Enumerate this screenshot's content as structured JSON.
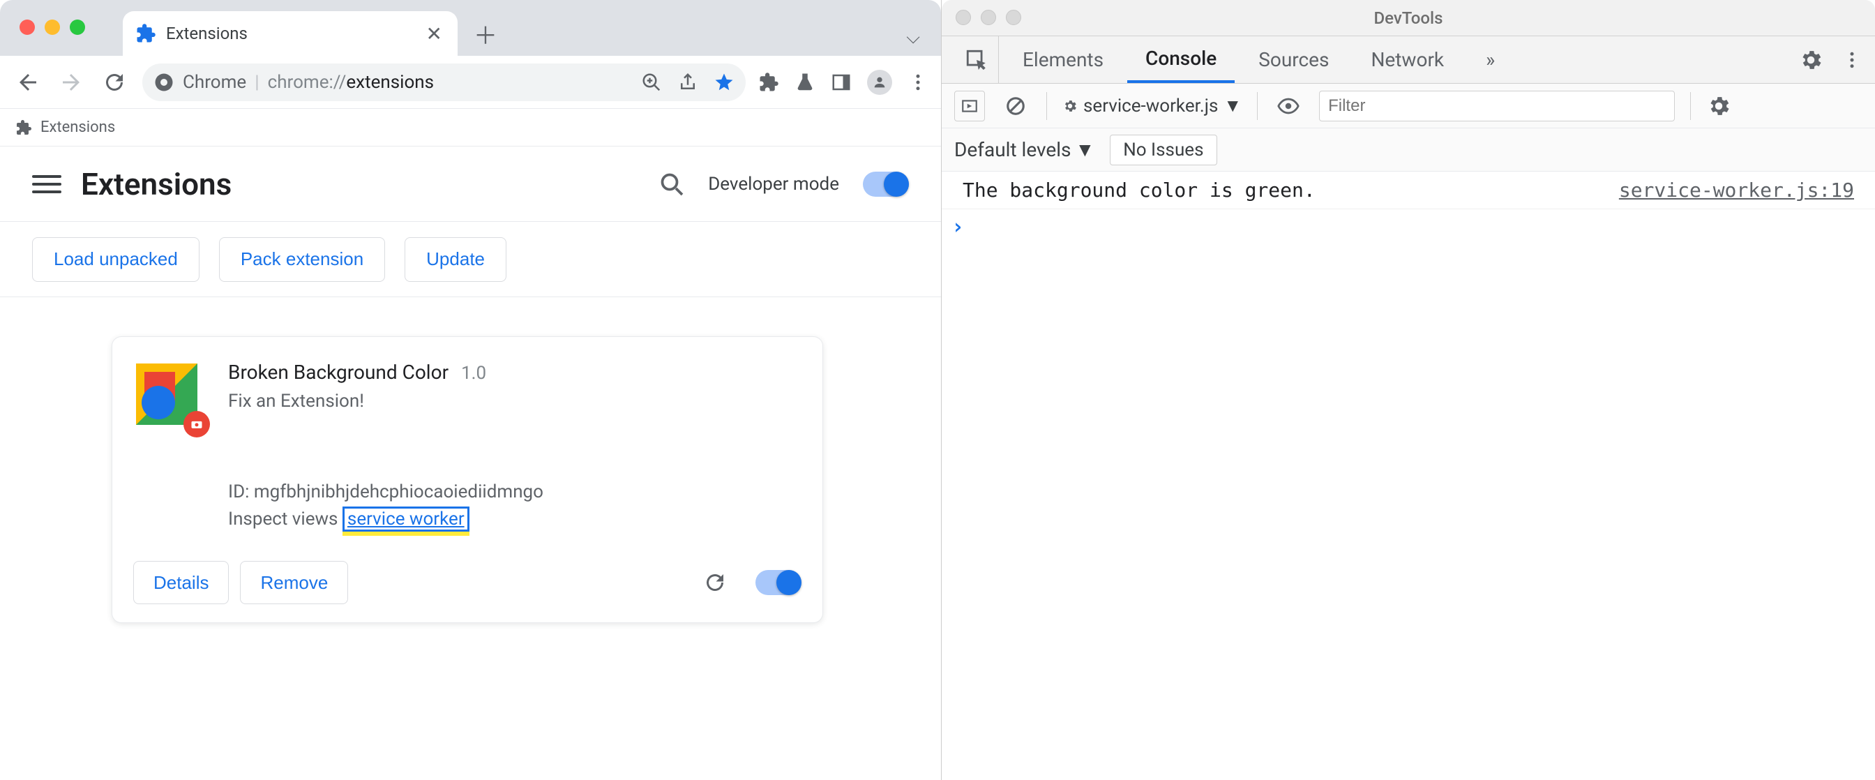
{
  "chrome": {
    "tab_title": "Extensions",
    "omnibox": {
      "origin": "Chrome",
      "url_prefix": "chrome://",
      "url_path": "extensions"
    },
    "breadcrumb": "Extensions",
    "extensions_page": {
      "title": "Extensions",
      "dev_mode_label": "Developer mode",
      "buttons": {
        "load_unpacked": "Load unpacked",
        "pack_extension": "Pack extension",
        "update": "Update"
      },
      "card": {
        "name": "Broken Background Color",
        "version": "1.0",
        "description": "Fix an Extension!",
        "id_label": "ID: mgfbhjnibhjdehcphiocaoiediidmngo",
        "inspect_label": "Inspect views",
        "service_worker_link": "service worker",
        "details_btn": "Details",
        "remove_btn": "Remove"
      }
    }
  },
  "devtools": {
    "window_title": "DevTools",
    "tabs": [
      "Elements",
      "Console",
      "Sources",
      "Network"
    ],
    "active_tab": "Console",
    "context": "service-worker.js",
    "filter_placeholder": "Filter",
    "levels_label": "Default levels",
    "issues_label": "No Issues",
    "log": {
      "message": "The background color is green.",
      "source": "service-worker.js:19"
    }
  }
}
